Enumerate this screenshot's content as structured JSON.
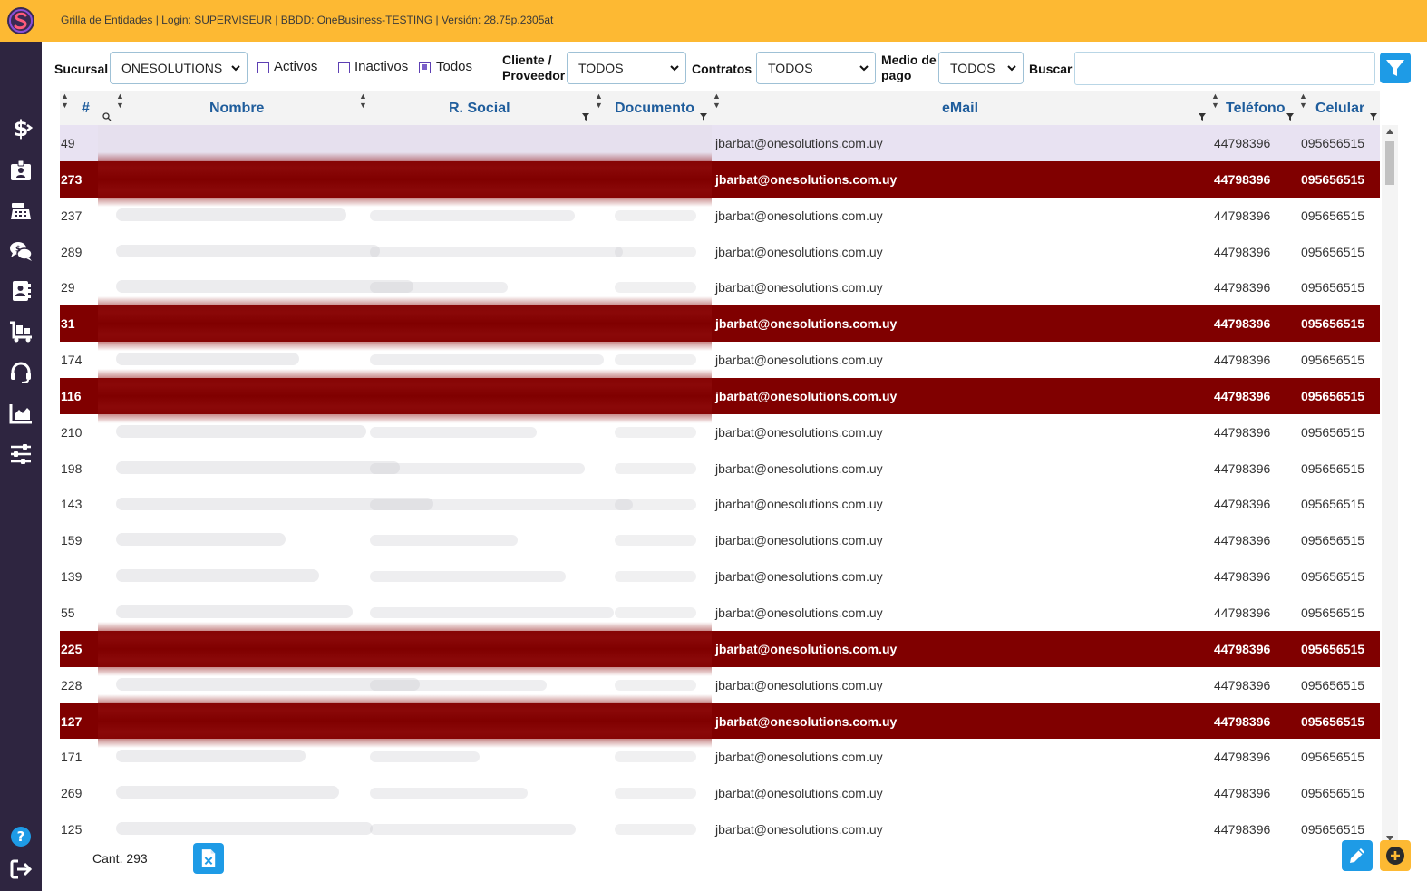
{
  "header": {
    "title": "Grilla de Entidades | Login: SUPERVISEUR | BBDD: OneBusiness-TESTING | Versión: 28.75p.2305at",
    "brand_color": "#fdb933",
    "sidebar_color": "#2e2540"
  },
  "sidebar": {
    "items": [
      {
        "icon": "dollar-icon"
      },
      {
        "icon": "id-badge-icon"
      },
      {
        "icon": "cash-register-icon"
      },
      {
        "icon": "comments-dollar-icon"
      },
      {
        "icon": "address-book-icon"
      },
      {
        "icon": "dolly-icon"
      },
      {
        "icon": "headset-icon"
      },
      {
        "icon": "chart-area-icon"
      },
      {
        "icon": "sliders-icon"
      }
    ],
    "bottom": [
      {
        "icon": "help-icon"
      },
      {
        "icon": "logout-icon"
      }
    ]
  },
  "filters": {
    "sucursal_label": "Sucursal",
    "sucursal_value": "ONESOLUTIONS",
    "activos_label": "Activos",
    "inactivos_label": "Inactivos",
    "todos_label": "Todos",
    "cliente_label_1": "Cliente /",
    "cliente_label_2": "Proveedor",
    "cliente_value": "TODOS",
    "contratos_label": "Contratos",
    "contratos_value": "TODOS",
    "medio_label_1": "Medio de",
    "medio_label_2": "pago",
    "medio_value": "TODOS",
    "buscar_label": "Buscar",
    "buscar_value": ""
  },
  "columns": {
    "id": "#",
    "nombre": "Nombre",
    "rsocial": "R. Social",
    "documento": "Documento",
    "email": "eMail",
    "telefono": "Teléfono",
    "celular": "Celular"
  },
  "rows": [
    {
      "id": "49",
      "email": "jbarbat@onesolutions.com.uy",
      "tel": "44798396",
      "cel": "095656515",
      "style": "selected"
    },
    {
      "id": "273",
      "email": "jbarbat@onesolutions.com.uy",
      "tel": "44798396",
      "cel": "095656515",
      "style": "dark"
    },
    {
      "id": "237",
      "email": "jbarbat@onesolutions.com.uy",
      "tel": "44798396",
      "cel": "095656515",
      "style": "normal"
    },
    {
      "id": "289",
      "email": "jbarbat@onesolutions.com.uy",
      "tel": "44798396",
      "cel": "095656515",
      "style": "normal"
    },
    {
      "id": "29",
      "email": "jbarbat@onesolutions.com.uy",
      "tel": "44798396",
      "cel": "095656515",
      "style": "normal"
    },
    {
      "id": "31",
      "email": "jbarbat@onesolutions.com.uy",
      "tel": "44798396",
      "cel": "095656515",
      "style": "dark"
    },
    {
      "id": "174",
      "email": "jbarbat@onesolutions.com.uy",
      "tel": "44798396",
      "cel": "095656515",
      "style": "normal"
    },
    {
      "id": "116",
      "email": "jbarbat@onesolutions.com.uy",
      "tel": "44798396",
      "cel": "095656515",
      "style": "dark"
    },
    {
      "id": "210",
      "email": "jbarbat@onesolutions.com.uy",
      "tel": "44798396",
      "cel": "095656515",
      "style": "normal"
    },
    {
      "id": "198",
      "email": "jbarbat@onesolutions.com.uy",
      "tel": "44798396",
      "cel": "095656515",
      "style": "normal"
    },
    {
      "id": "143",
      "email": "jbarbat@onesolutions.com.uy",
      "tel": "44798396",
      "cel": "095656515",
      "style": "normal"
    },
    {
      "id": "159",
      "email": "jbarbat@onesolutions.com.uy",
      "tel": "44798396",
      "cel": "095656515",
      "style": "normal"
    },
    {
      "id": "139",
      "email": "jbarbat@onesolutions.com.uy",
      "tel": "44798396",
      "cel": "095656515",
      "style": "normal"
    },
    {
      "id": "55",
      "email": "jbarbat@onesolutions.com.uy",
      "tel": "44798396",
      "cel": "095656515",
      "style": "normal"
    },
    {
      "id": "225",
      "email": "jbarbat@onesolutions.com.uy",
      "tel": "44798396",
      "cel": "095656515",
      "style": "dark"
    },
    {
      "id": "228",
      "email": "jbarbat@onesolutions.com.uy",
      "tel": "44798396",
      "cel": "095656515",
      "style": "normal"
    },
    {
      "id": "127",
      "email": "jbarbat@onesolutions.com.uy",
      "tel": "44798396",
      "cel": "095656515",
      "style": "dark"
    },
    {
      "id": "171",
      "email": "jbarbat@onesolutions.com.uy",
      "tel": "44798396",
      "cel": "095656515",
      "style": "normal"
    },
    {
      "id": "269",
      "email": "jbarbat@onesolutions.com.uy",
      "tel": "44798396",
      "cel": "095656515",
      "style": "normal"
    },
    {
      "id": "125",
      "email": "jbarbat@onesolutions.com.uy",
      "tel": "44798396",
      "cel": "095656515",
      "style": "normal"
    }
  ],
  "footer": {
    "count": "Cant. 293"
  }
}
